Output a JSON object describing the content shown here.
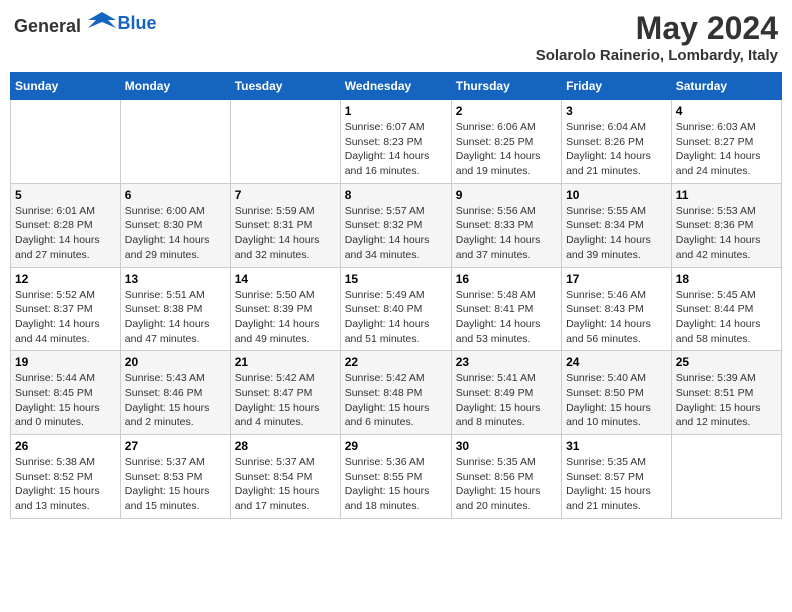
{
  "header": {
    "logo_general": "General",
    "logo_blue": "Blue",
    "month_year": "May 2024",
    "location": "Solarolo Rainerio, Lombardy, Italy"
  },
  "days_of_week": [
    "Sunday",
    "Monday",
    "Tuesday",
    "Wednesday",
    "Thursday",
    "Friday",
    "Saturday"
  ],
  "weeks": [
    [
      {
        "day": "",
        "info": ""
      },
      {
        "day": "",
        "info": ""
      },
      {
        "day": "",
        "info": ""
      },
      {
        "day": "1",
        "info": "Sunrise: 6:07 AM\nSunset: 8:23 PM\nDaylight: 14 hours\nand 16 minutes."
      },
      {
        "day": "2",
        "info": "Sunrise: 6:06 AM\nSunset: 8:25 PM\nDaylight: 14 hours\nand 19 minutes."
      },
      {
        "day": "3",
        "info": "Sunrise: 6:04 AM\nSunset: 8:26 PM\nDaylight: 14 hours\nand 21 minutes."
      },
      {
        "day": "4",
        "info": "Sunrise: 6:03 AM\nSunset: 8:27 PM\nDaylight: 14 hours\nand 24 minutes."
      }
    ],
    [
      {
        "day": "5",
        "info": "Sunrise: 6:01 AM\nSunset: 8:28 PM\nDaylight: 14 hours\nand 27 minutes."
      },
      {
        "day": "6",
        "info": "Sunrise: 6:00 AM\nSunset: 8:30 PM\nDaylight: 14 hours\nand 29 minutes."
      },
      {
        "day": "7",
        "info": "Sunrise: 5:59 AM\nSunset: 8:31 PM\nDaylight: 14 hours\nand 32 minutes."
      },
      {
        "day": "8",
        "info": "Sunrise: 5:57 AM\nSunset: 8:32 PM\nDaylight: 14 hours\nand 34 minutes."
      },
      {
        "day": "9",
        "info": "Sunrise: 5:56 AM\nSunset: 8:33 PM\nDaylight: 14 hours\nand 37 minutes."
      },
      {
        "day": "10",
        "info": "Sunrise: 5:55 AM\nSunset: 8:34 PM\nDaylight: 14 hours\nand 39 minutes."
      },
      {
        "day": "11",
        "info": "Sunrise: 5:53 AM\nSunset: 8:36 PM\nDaylight: 14 hours\nand 42 minutes."
      }
    ],
    [
      {
        "day": "12",
        "info": "Sunrise: 5:52 AM\nSunset: 8:37 PM\nDaylight: 14 hours\nand 44 minutes."
      },
      {
        "day": "13",
        "info": "Sunrise: 5:51 AM\nSunset: 8:38 PM\nDaylight: 14 hours\nand 47 minutes."
      },
      {
        "day": "14",
        "info": "Sunrise: 5:50 AM\nSunset: 8:39 PM\nDaylight: 14 hours\nand 49 minutes."
      },
      {
        "day": "15",
        "info": "Sunrise: 5:49 AM\nSunset: 8:40 PM\nDaylight: 14 hours\nand 51 minutes."
      },
      {
        "day": "16",
        "info": "Sunrise: 5:48 AM\nSunset: 8:41 PM\nDaylight: 14 hours\nand 53 minutes."
      },
      {
        "day": "17",
        "info": "Sunrise: 5:46 AM\nSunset: 8:43 PM\nDaylight: 14 hours\nand 56 minutes."
      },
      {
        "day": "18",
        "info": "Sunrise: 5:45 AM\nSunset: 8:44 PM\nDaylight: 14 hours\nand 58 minutes."
      }
    ],
    [
      {
        "day": "19",
        "info": "Sunrise: 5:44 AM\nSunset: 8:45 PM\nDaylight: 15 hours\nand 0 minutes."
      },
      {
        "day": "20",
        "info": "Sunrise: 5:43 AM\nSunset: 8:46 PM\nDaylight: 15 hours\nand 2 minutes."
      },
      {
        "day": "21",
        "info": "Sunrise: 5:42 AM\nSunset: 8:47 PM\nDaylight: 15 hours\nand 4 minutes."
      },
      {
        "day": "22",
        "info": "Sunrise: 5:42 AM\nSunset: 8:48 PM\nDaylight: 15 hours\nand 6 minutes."
      },
      {
        "day": "23",
        "info": "Sunrise: 5:41 AM\nSunset: 8:49 PM\nDaylight: 15 hours\nand 8 minutes."
      },
      {
        "day": "24",
        "info": "Sunrise: 5:40 AM\nSunset: 8:50 PM\nDaylight: 15 hours\nand 10 minutes."
      },
      {
        "day": "25",
        "info": "Sunrise: 5:39 AM\nSunset: 8:51 PM\nDaylight: 15 hours\nand 12 minutes."
      }
    ],
    [
      {
        "day": "26",
        "info": "Sunrise: 5:38 AM\nSunset: 8:52 PM\nDaylight: 15 hours\nand 13 minutes."
      },
      {
        "day": "27",
        "info": "Sunrise: 5:37 AM\nSunset: 8:53 PM\nDaylight: 15 hours\nand 15 minutes."
      },
      {
        "day": "28",
        "info": "Sunrise: 5:37 AM\nSunset: 8:54 PM\nDaylight: 15 hours\nand 17 minutes."
      },
      {
        "day": "29",
        "info": "Sunrise: 5:36 AM\nSunset: 8:55 PM\nDaylight: 15 hours\nand 18 minutes."
      },
      {
        "day": "30",
        "info": "Sunrise: 5:35 AM\nSunset: 8:56 PM\nDaylight: 15 hours\nand 20 minutes."
      },
      {
        "day": "31",
        "info": "Sunrise: 5:35 AM\nSunset: 8:57 PM\nDaylight: 15 hours\nand 21 minutes."
      },
      {
        "day": "",
        "info": ""
      }
    ]
  ]
}
